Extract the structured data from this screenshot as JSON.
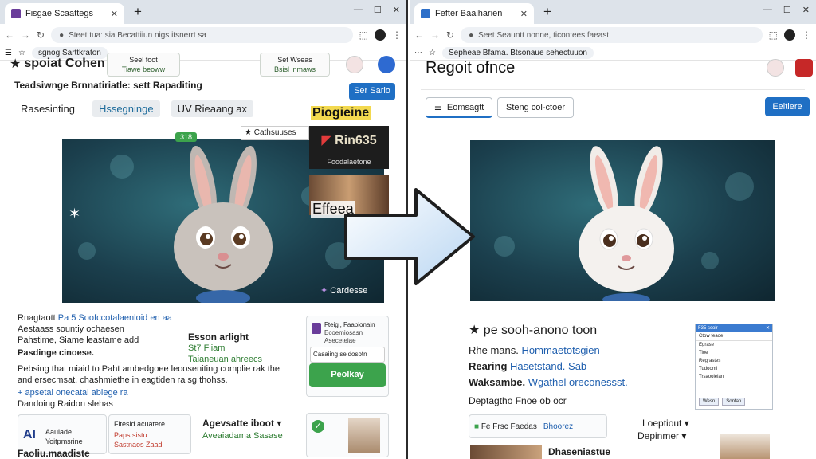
{
  "colors": {
    "accent_blue": "#1f6fc4",
    "accent_green": "#3ca34c",
    "hero_bg": "#1b3f4d",
    "tab_strip": "#dde3ea",
    "left_favicon": "#6a3d9a",
    "right_favicon": "#2d6fc9"
  },
  "left_browser": {
    "tab_title": "Fisgae Scaattegs",
    "omnibox": "Steet tua: sia Becattiiun nigs itsnerrt sa",
    "bookmark": "sgnog Sarttkraton",
    "header": {
      "title": "spoiat Cohen",
      "chip1_line1": "Seel foot",
      "chip1_line2": "Tiawe beoww",
      "chip2_line1": "Set Wseas",
      "chip2_line2": "Bsisl inmaws"
    },
    "subheading": "Teadsiwnge  Brnnatiriatle: sett  Rapaditing",
    "action_button": "Ser Sario",
    "tabs": [
      "Rasesinting",
      "Hssegninge",
      "UV Rieaang ax"
    ],
    "hero_caption": "Cardesse",
    "hero_tooltip": "Cathsuuses",
    "side_label": "Piogieine",
    "side_price": "Rin635",
    "side_sub": "Foodalaetone",
    "thumb_label": "Effeea",
    "badge": "318",
    "info": {
      "line1_label": "Rnagtaott",
      "line1_value": "Pa 5 Soofccotalaenloid en aa",
      "line2": "Aestaass sountiy ochaesen",
      "line3": "Pahstime, Siame leastame add",
      "line4": "Pasdinge cinoese.",
      "line5": "Pebsing that miaid to Paht ambedgoee  leooseniting complie rak the",
      "line6": "and ersecmsat. chashmiethe in eagtiden ra sg thohss.",
      "line7": "+ apsetal onecatal abiege ra",
      "line8": "Dandoing Raidon slehas",
      "middle_title": "Esson arlight",
      "middle_line1": "St7 Fiiam",
      "middle_line2": "Taianeuan ahreecs"
    },
    "card": {
      "title": "Fteigi, Faabionaln",
      "body": "Ecoemiosasn Aseceteiae",
      "link": "Casaiing seldosotn",
      "button": "Peolkay"
    },
    "bottom": {
      "ai_label": "Aaulade",
      "ai_sub": "Yoitpmsrine",
      "block_title": "Fitesid acuatere",
      "block_line1": "Papstsistu",
      "block_line2": "Sastnaos  Zaad",
      "right_title": "Agevsatte iboot",
      "right_sub": "Aveaiadama  Sasase",
      "footer": "Faoliu.maadiste"
    }
  },
  "right_browser": {
    "tab_title": "Fefter Baalharien",
    "omnibox": "Seet Seauntt nonne, ticontees faeast",
    "bookmark": "Sepheae Bfama.  Btsonaue sehectuuon",
    "title": "Regoit ofnce",
    "button1": "Eomsagtt",
    "button2": "Steng col-ctoer",
    "button3": "Eeltiere",
    "section_title": "pe sooh-anono toon",
    "row1_label": "Rhe mans.",
    "row1_value": "Hommaetotsgien",
    "row2_label": "Rearing",
    "row2_value": "Hasetstand. Sab",
    "row3_label": "Waksambe.",
    "row3_value": "Wgathel oreconessst.",
    "row4": "Deptagtho Fnoe ob ocr",
    "chip1": "Fe Frsc Faedas",
    "chip2": "Bhoorez",
    "link1": "Loeptiout",
    "link2": "Depinmer",
    "bottom_label": "Dhaseniastue",
    "mini_title": "F35 scoir",
    "mini_rows": [
      "Ctow feaoe",
      "Egrase",
      "Tioe",
      "Regrastes",
      "Tudoomi",
      "Trsaoolelan"
    ],
    "mini_buttons": [
      "Wesn",
      "Sonfan"
    ]
  }
}
